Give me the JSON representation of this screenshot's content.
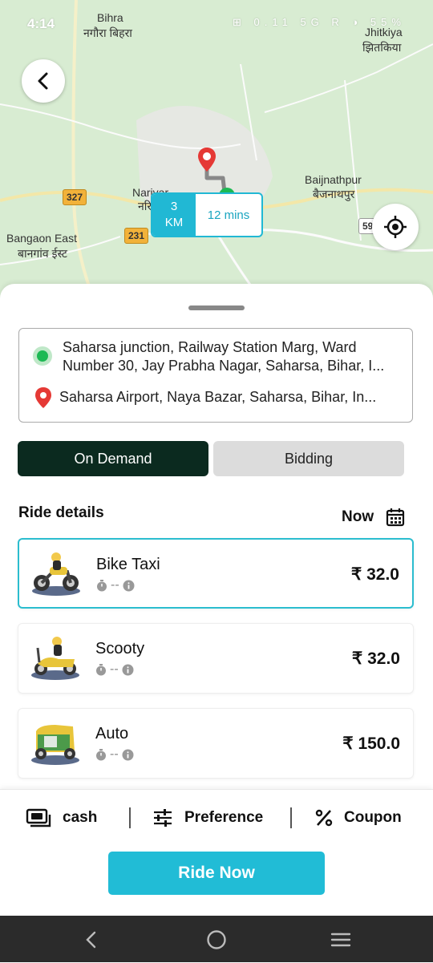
{
  "status_bar": {
    "time": "4:14",
    "indicators": "⊞ 0.11 5G R ◑ 55%"
  },
  "map": {
    "labels": [
      {
        "text": "Bihra"
      },
      {
        "text": "नगौरा बिहरा"
      },
      {
        "text": "Jhitkiya"
      },
      {
        "text": "झितकिया"
      },
      {
        "text": "Narivar"
      },
      {
        "text": "नरि"
      },
      {
        "text": "Baijnathpur"
      },
      {
        "text": "बैजनाथपुर"
      },
      {
        "text": "Bangaon East"
      },
      {
        "text": "बानगांव ईस्ट"
      }
    ],
    "road_shields": [
      "327",
      "231",
      "59"
    ],
    "distance": {
      "km_value": "3",
      "km_unit": "KM",
      "duration": "12 mins"
    }
  },
  "addresses": {
    "pickup": "Saharsa junction, Railway Station Marg, Ward Number 30, Jay Prabha Nagar, Saharsa, Bihar, I...",
    "drop": "Saharsa Airport, Naya Bazar, Saharsa, Bihar, In..."
  },
  "modes": {
    "on_demand": "On Demand",
    "bidding": "Bidding"
  },
  "ride_details": {
    "title": "Ride details",
    "when": "Now"
  },
  "rides": [
    {
      "name": "Bike Taxi",
      "meta": "--",
      "price": "₹ 32.0"
    },
    {
      "name": "Scooty",
      "meta": "--",
      "price": "₹ 32.0"
    },
    {
      "name": "Auto",
      "meta": "--",
      "price": "₹ 150.0"
    }
  ],
  "options": {
    "payment": "cash",
    "preference": "Preference",
    "coupon": "Coupon"
  },
  "cta": "Ride Now",
  "colors": {
    "accent": "#21bcd6",
    "dark_green": "#0b2a1f",
    "pickup_green": "#1db954",
    "drop_red": "#e53935"
  }
}
